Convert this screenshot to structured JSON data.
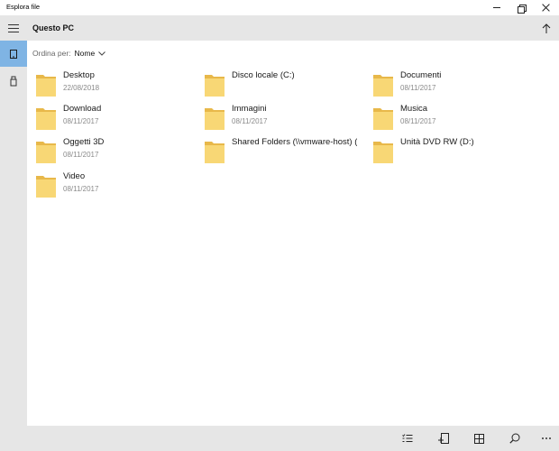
{
  "window": {
    "title": "Esplora file"
  },
  "header": {
    "location_title": "Questo PC"
  },
  "sort": {
    "label": "Ordina per:",
    "value": "Nome"
  },
  "items": [
    {
      "name": "Desktop",
      "date": "22/08/2018",
      "icon": "folder-icon"
    },
    {
      "name": "Disco locale (C:)",
      "date": "",
      "icon": "folder-icon"
    },
    {
      "name": "Documenti",
      "date": "08/11/2017",
      "icon": "folder-icon"
    },
    {
      "name": "Download",
      "date": "08/11/2017",
      "icon": "folder-icon"
    },
    {
      "name": "Immagini",
      "date": "08/11/2017",
      "icon": "folder-icon"
    },
    {
      "name": "Musica",
      "date": "08/11/2017",
      "icon": "folder-icon"
    },
    {
      "name": "Oggetti 3D",
      "date": "08/11/2017",
      "icon": "folder-icon"
    },
    {
      "name": "Shared Folders (\\\\vmware-host) (",
      "date": "",
      "icon": "folder-icon"
    },
    {
      "name": "Unità DVD RW (D:)",
      "date": "",
      "icon": "folder-icon"
    },
    {
      "name": "Video",
      "date": "08/11/2017",
      "icon": "folder-icon"
    }
  ],
  "colors": {
    "chrome": "#e6e6e6",
    "accent_selected": "#7fb4e4",
    "folder_fill": "#f8d775",
    "folder_tab": "#e8b84a"
  }
}
